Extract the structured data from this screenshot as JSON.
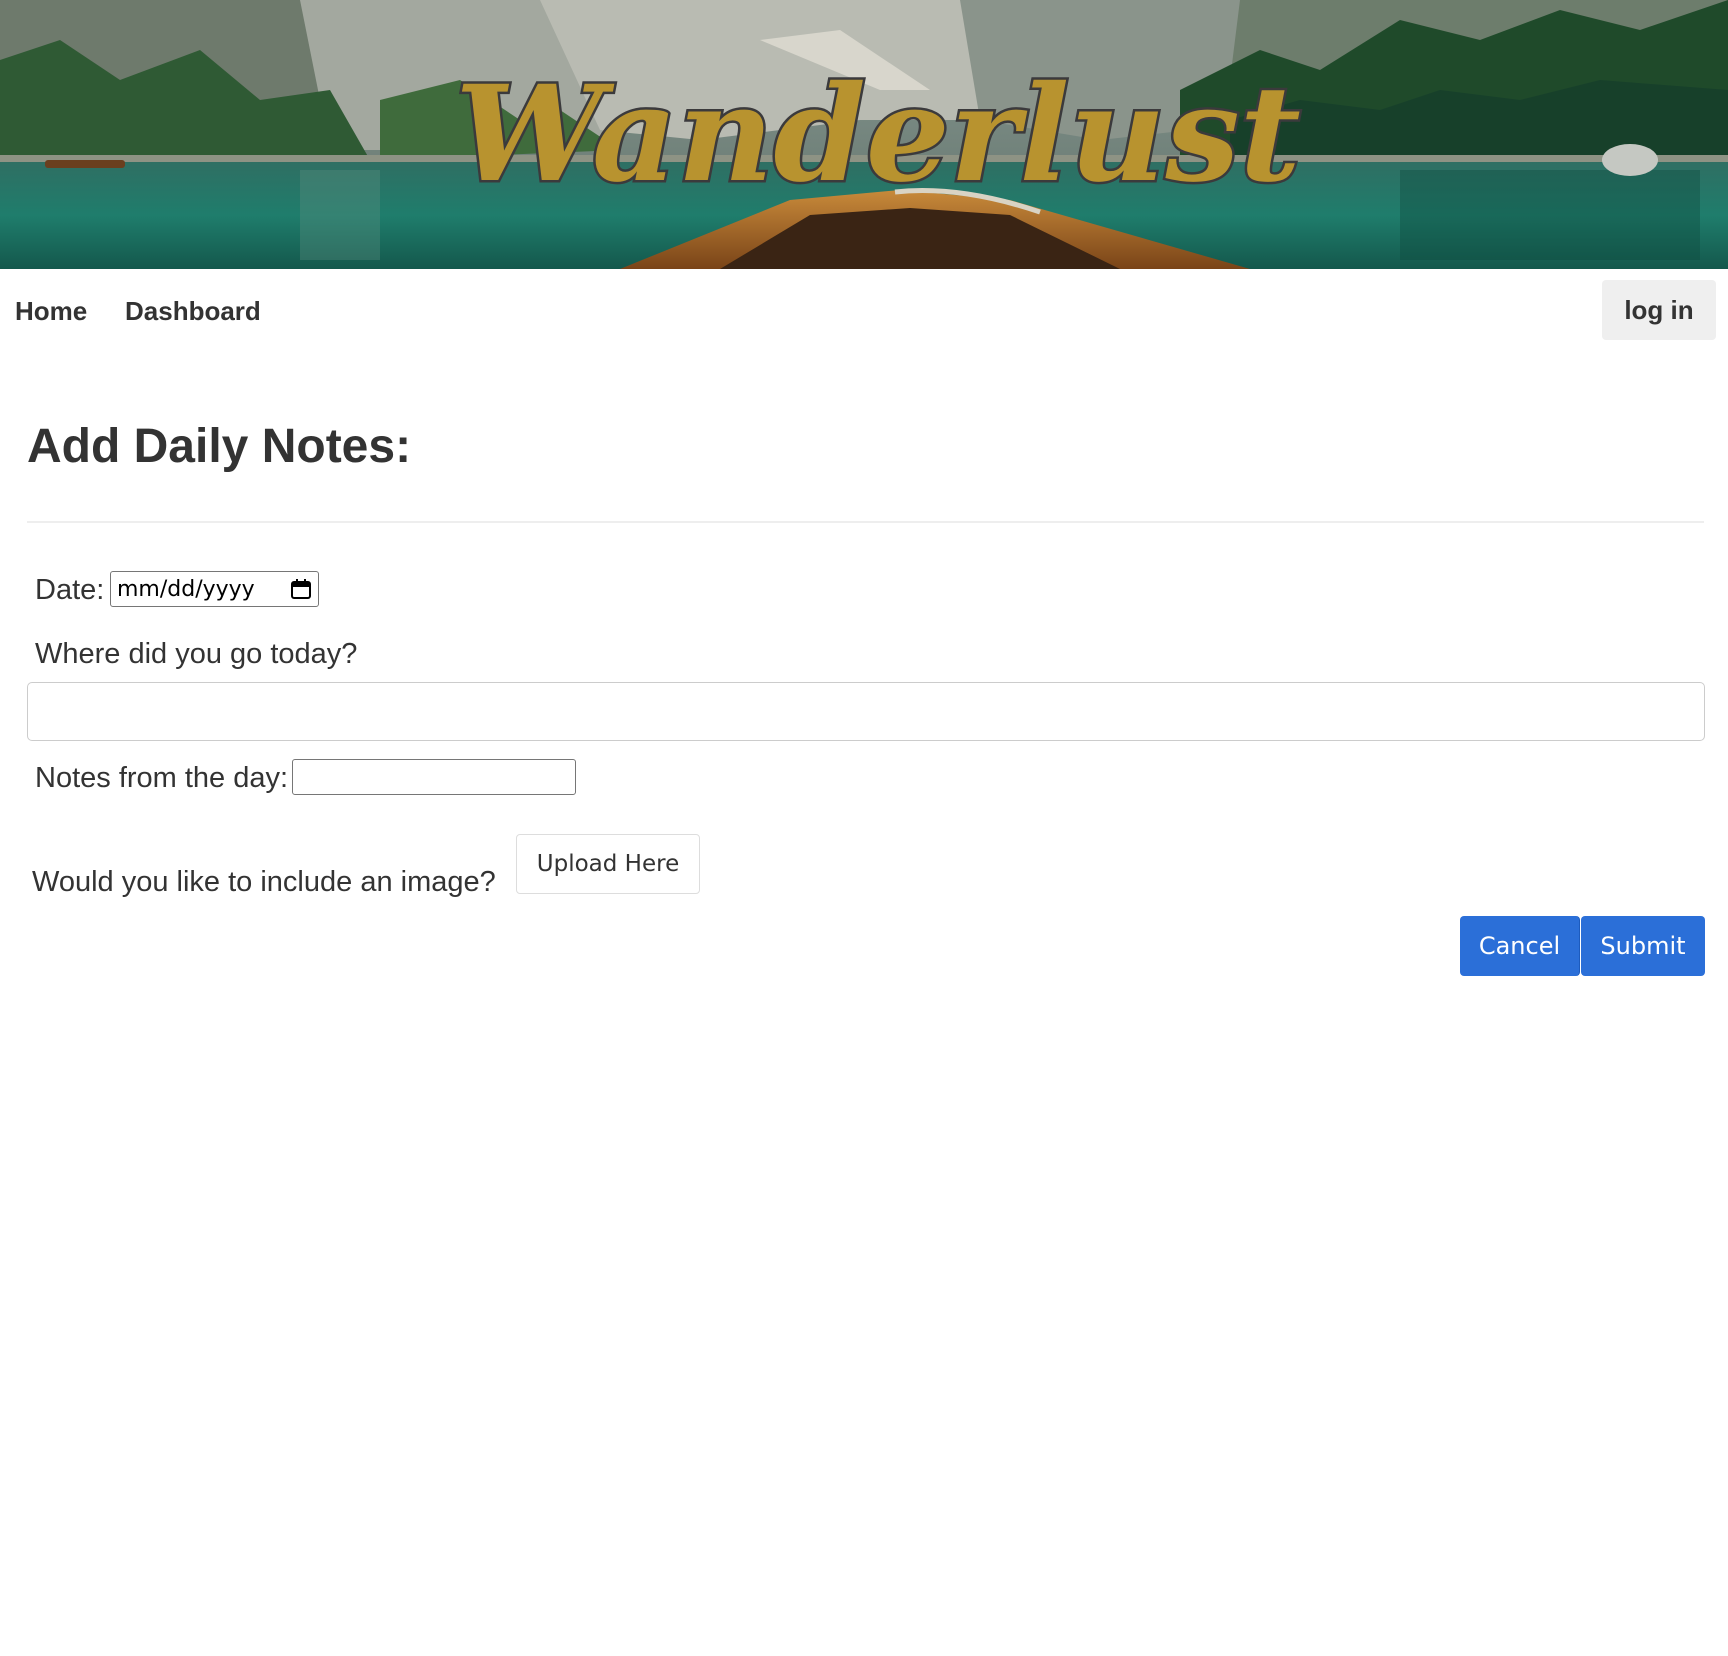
{
  "header": {
    "brand": "Wanderlust",
    "brand_color": "#b8932f"
  },
  "nav": {
    "home": "Home",
    "dashboard": "Dashboard",
    "login": "log in"
  },
  "form": {
    "title": "Add Daily Notes:",
    "date_label": "Date:",
    "date_placeholder": "mm/dd/yyyy",
    "where_label": "Where did you go today?",
    "where_value": "",
    "notes_label": "Notes from the day:",
    "notes_value": "",
    "image_label": "Would you like to include an image?",
    "upload_label": "Upload Here",
    "cancel_label": "Cancel",
    "submit_label": "Submit",
    "accent": "#2b6fd8"
  },
  "icons": {
    "date_picker": "calendar-icon"
  }
}
